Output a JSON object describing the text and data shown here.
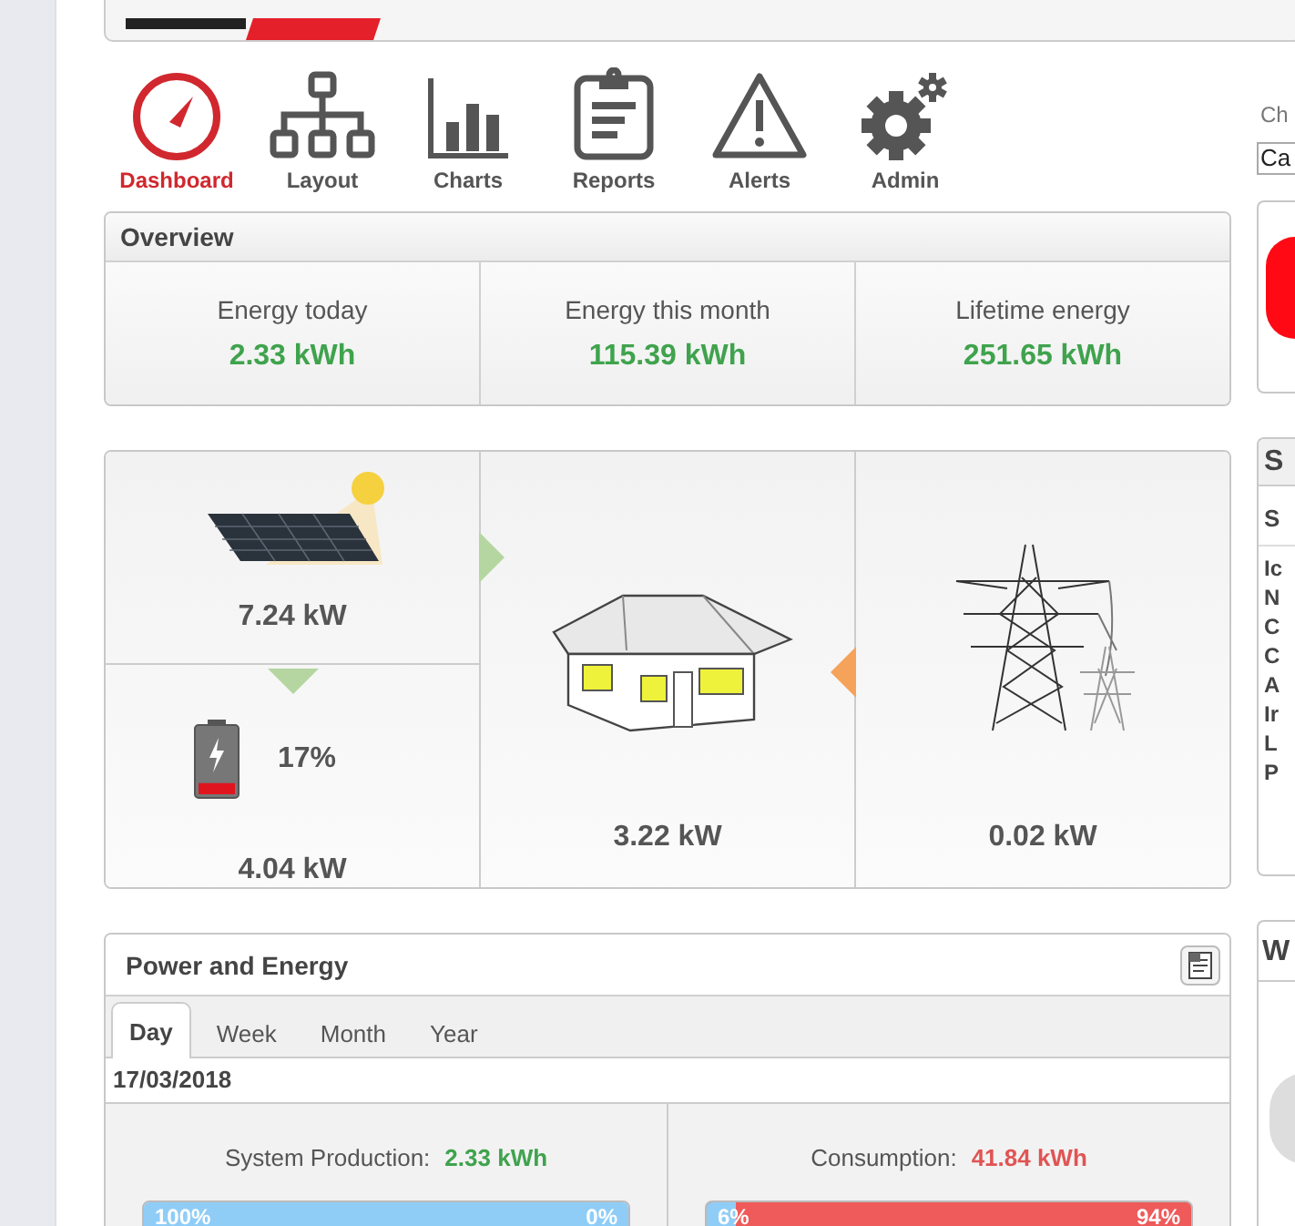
{
  "nav": [
    {
      "label": "Dashboard",
      "selected": true,
      "kind": "gauge"
    },
    {
      "label": "Layout",
      "selected": false,
      "kind": "layout"
    },
    {
      "label": "Charts",
      "selected": false,
      "kind": "charts"
    },
    {
      "label": "Reports",
      "selected": false,
      "kind": "reports"
    },
    {
      "label": "Alerts",
      "selected": false,
      "kind": "alerts"
    },
    {
      "label": "Admin",
      "selected": false,
      "kind": "admin"
    }
  ],
  "overview": {
    "title": "Overview",
    "stats": [
      {
        "label": "Energy today",
        "value": "2.33 kWh"
      },
      {
        "label": "Energy this month",
        "value": "115.39 kWh"
      },
      {
        "label": "Lifetime energy",
        "value": "251.65 kWh"
      }
    ]
  },
  "power_flow": {
    "pv": {
      "power": "7.24 kW"
    },
    "battery": {
      "charge": "17%",
      "level": 0.17,
      "power": "4.04 kW"
    },
    "load": {
      "power": "3.22 kW"
    },
    "grid": {
      "power": "0.02 kW"
    },
    "flows": [
      {
        "kind": "pv_to_load",
        "color": "#b5d6a0"
      },
      {
        "kind": "pv_to_battery",
        "color": "#b5d6a0"
      },
      {
        "kind": "grid_to_load",
        "color": "#f5a35a"
      }
    ]
  },
  "power_and_energy": {
    "title": "Power and Energy",
    "tabs": [
      {
        "label": "Day",
        "selected": true
      },
      {
        "label": "Week",
        "selected": false
      },
      {
        "label": "Month",
        "selected": false
      },
      {
        "label": "Year",
        "selected": false
      }
    ],
    "date": "17/03/2018",
    "summaries": [
      {
        "kind": "production",
        "label": "System Production:",
        "value": "2.33 kWh",
        "level": 1.0,
        "left_label": "100%",
        "right_label": "0%"
      },
      {
        "kind": "consumption",
        "label": "Consumption:",
        "value": "41.84 kWh",
        "level": 0.06,
        "left_label": "6%",
        "right_label": "94%"
      }
    ]
  },
  "right_column": {
    "label": "Ch",
    "select_value": "Ca",
    "panel_heading": "S",
    "panel_subheading": "S",
    "panel_lines": [
      "Ic",
      "N",
      "C",
      "C",
      "A",
      "Ir",
      "L",
      "P"
    ],
    "bottom_panel_heading": "W"
  }
}
